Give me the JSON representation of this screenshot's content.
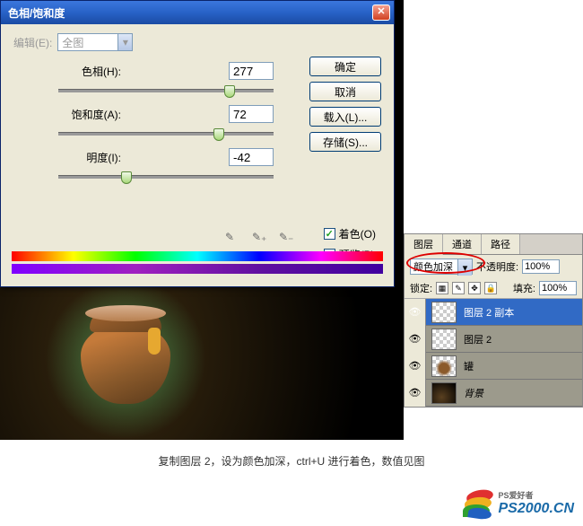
{
  "dialog": {
    "title": "色相/饱和度",
    "edit_label": "编辑(E):",
    "edit_value": "全图",
    "hue_label": "色相(H):",
    "hue_value": "277",
    "saturation_label": "饱和度(A):",
    "saturation_value": "72",
    "lightness_label": "明度(I):",
    "lightness_value": "-42",
    "colorize_label": "着色(O)",
    "preview_label": "预览(P)",
    "buttons": {
      "ok": "确定",
      "cancel": "取消",
      "load": "载入(L)...",
      "save": "存储(S)..."
    }
  },
  "layers": {
    "tabs": [
      "图层",
      "通道",
      "路径"
    ],
    "blend_mode": "颜色加深",
    "opacity_label": "不透明度:",
    "opacity_value": "100%",
    "lock_label": "锁定:",
    "fill_label": "填充:",
    "fill_value": "100%",
    "items": [
      {
        "name": "图层 2 副本",
        "selected": true
      },
      {
        "name": "图层 2",
        "selected": false
      },
      {
        "name": "罐",
        "selected": false
      },
      {
        "name": "背景",
        "selected": false,
        "italic": true
      }
    ]
  },
  "caption": "复制图层 2，设为颜色加深，ctrl+U 进行着色，数值见图",
  "watermark": {
    "brand": "PS爱好者",
    "url": "PS2000.cn"
  },
  "logo": {
    "brand": "PS爱好者",
    "url": "PS2000.CN"
  }
}
